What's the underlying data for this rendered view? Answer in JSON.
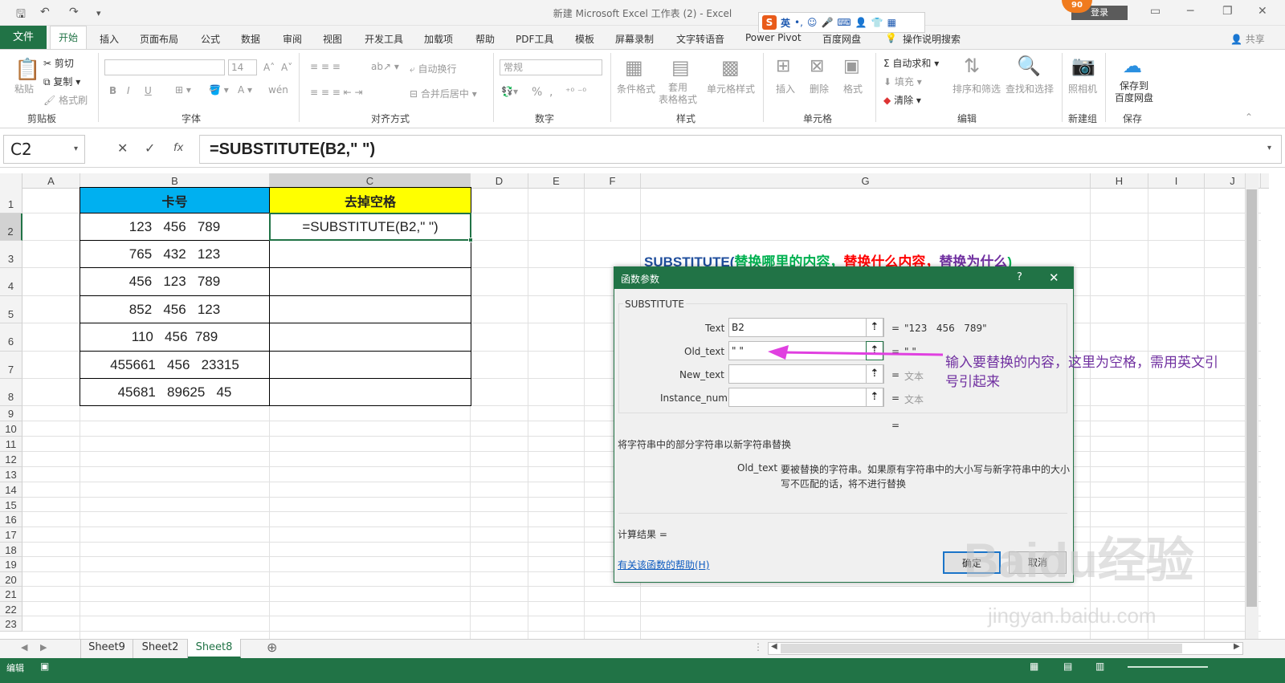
{
  "window": {
    "title": "新建 Microsoft Excel 工作表 (2)  -  Excel",
    "login": "登录",
    "share": "共享",
    "badge": "90"
  },
  "qat": {
    "save": "🖫",
    "undo": "↶",
    "redo": "↷",
    "more": "▾"
  },
  "ime": {
    "logo": "S",
    "lang": "英",
    "punct": "•,",
    "smile": "☺",
    "mic": "🎤",
    "kbd": "⌨",
    "user": "👤",
    "shirt": "👕",
    "grid": "▦"
  },
  "menu": {
    "file": "文件",
    "items": [
      "开始",
      "插入",
      "页面布局",
      "公式",
      "数据",
      "审阅",
      "视图",
      "开发工具",
      "加载项",
      "帮助",
      "PDF工具",
      "模板",
      "屏幕录制",
      "文字转语音",
      "Power Pivot",
      "百度网盘",
      "操作说明搜索"
    ]
  },
  "ribbon": {
    "clipboard": {
      "paste": "粘贴",
      "cut": "剪切",
      "copy": "复制",
      "format_painter": "格式刷",
      "label": "剪贴板"
    },
    "font": {
      "size": "14",
      "label": "字体",
      "grow": "A˄",
      "shrink": "A˅",
      "bold": "B",
      "italic": "I",
      "underline": "U",
      "wen": "wén"
    },
    "align": {
      "wrap": "自动换行",
      "merge": "合并后居中",
      "label": "对齐方式"
    },
    "number": {
      "format": "常规",
      "label": "数字",
      "percent": "%",
      "comma": ","
    },
    "styles": {
      "cond": "条件格式",
      "table": "套用\n表格格式",
      "cell": "单元格样式",
      "label": "样式"
    },
    "cells": {
      "insert": "插入",
      "delete": "删除",
      "format": "格式",
      "label": "单元格"
    },
    "edit": {
      "autosum": "自动求和",
      "fill": "填充",
      "clear": "清除",
      "sort": "排序和筛选",
      "find": "查找和选择",
      "label": "编辑"
    },
    "newgrp": {
      "camera": "照相机",
      "label": "新建组"
    },
    "save": {
      "baidu": "保存到\n百度网盘",
      "label": "保存"
    }
  },
  "formula_bar": {
    "name_box": "C2",
    "cancel": "✕",
    "enter": "✓",
    "fx": "fx",
    "formula": "=SUBSTITUTE(B2,\" \")"
  },
  "columns": [
    "A",
    "B",
    "C",
    "D",
    "E",
    "F",
    "G",
    "H",
    "I",
    "J"
  ],
  "rows": [
    "1",
    "2",
    "3",
    "4",
    "5",
    "6",
    "7",
    "8",
    "9",
    "10",
    "11",
    "12",
    "13",
    "14",
    "15",
    "16",
    "17",
    "18",
    "19",
    "20",
    "21",
    "22",
    "23"
  ],
  "table": {
    "header_b": "卡号",
    "header_c": "去掉空格",
    "header_b_color": "#00b0f0",
    "header_c_color": "#ffff00",
    "b_values": [
      "123   456   789",
      "765   432   123",
      "456   123   789",
      "852   456   123",
      "110   456  789",
      "455661   456   23315",
      "45681   89625   45"
    ],
    "c2": "=SUBSTITUTE(B2,\" \")"
  },
  "annotation": {
    "syntax_func": "SUBSTITUTE(",
    "syntax_a": "替换哪里的内容，",
    "syntax_b": "替换什么内容，",
    "syntax_c": "替换为什么",
    "syntax_end": ")",
    "arrow_note_1": "输入要替换的内容，这里为空格，需用英文引",
    "arrow_note_2": "号引起来",
    "colors": {
      "func": "#1f4e9c",
      "a": "#00b050",
      "b": "#ff0000",
      "c": "#7030a0",
      "note": "#7030a0",
      "arrow": "#e040e0"
    }
  },
  "dialog": {
    "title": "函数参数",
    "help_q": "?",
    "close": "✕",
    "func_name": "SUBSTITUTE",
    "args": [
      {
        "label": "Text",
        "value": "B2",
        "result": "\"123   456   789\""
      },
      {
        "label": "Old_text",
        "value": "\" \"",
        "result": "\" \""
      },
      {
        "label": "New_text",
        "value": "",
        "result": "文本"
      },
      {
        "label": "Instance_num",
        "value": "",
        "result": "文本"
      }
    ],
    "eq": "=",
    "total_eq": "=",
    "desc": "将字符串中的部分字符串以新字符串替换",
    "param_name": "Old_text",
    "param_desc_1": "要被替换的字符串。如果原有字符串中的大小写与新字符串中的大小",
    "param_desc_2": "写不匹配的话，将不进行替换",
    "calc_result": "计算结果 =",
    "help_link": "有关该函数的帮助(H)",
    "ok": "确定",
    "cancel": "取消"
  },
  "sheets": [
    "Sheet9",
    "Sheet2",
    "Sheet8"
  ],
  "active_sheet": "Sheet8",
  "status": {
    "mode": "编辑"
  },
  "watermark": {
    "main": "Baidu经验",
    "sub": "jingyan.baidu.com"
  }
}
